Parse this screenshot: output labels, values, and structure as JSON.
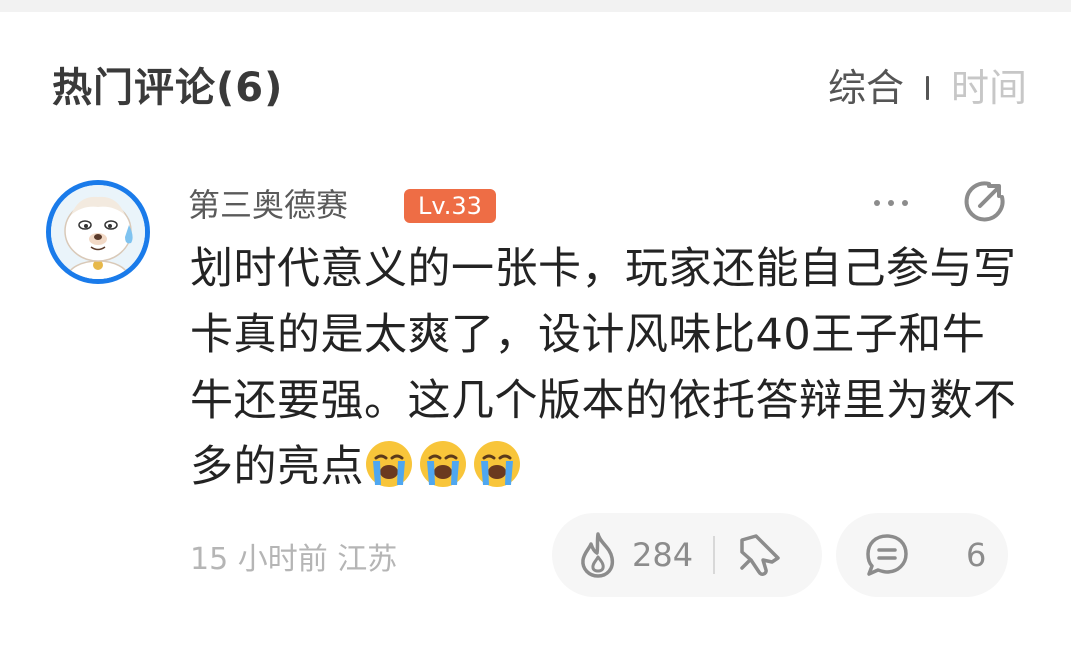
{
  "header": {
    "title": "热门评论(6)",
    "sort_tabs": [
      {
        "label": "综合",
        "active": true
      },
      {
        "label": "时间",
        "active": false
      }
    ]
  },
  "comment": {
    "username": "第三奥德赛",
    "level": "Lv.33",
    "text": "划时代意义的一张卡，玩家还能自己参与写卡真的是太爽了，设计风味比40王子和牛牛还要强。这几个版本的依托答辩里为数不多的亮点",
    "emojis": [
      "loudly-crying-face",
      "loudly-crying-face",
      "loudly-crying-face"
    ],
    "time": "15 小时前",
    "location": "江苏",
    "likes": "284",
    "replies": "6"
  },
  "colors": {
    "level_badge": "#ee6d45",
    "avatar_ring": "#1a7bea",
    "muted_text": "#b5b5b5",
    "pill_bg": "#f6f6f6"
  }
}
